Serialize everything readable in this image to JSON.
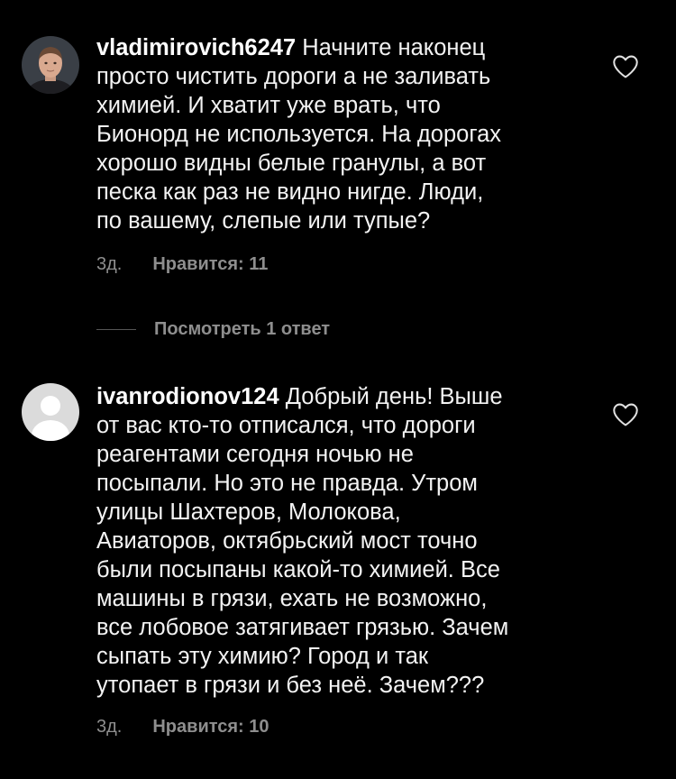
{
  "colors": {
    "background": "#000000",
    "text": "#f3f3f3",
    "meta": "#8e8e8e",
    "avatar_default_bg": "#dbdbdb"
  },
  "comments": [
    {
      "username": "vladimirovich6247",
      "avatar_icon": "user-photo-avatar",
      "lines": [
        "Начните наконец",
        "просто чистить дороги а не заливать",
        "химией. И хватит уже врать, что",
        "Бионорд не используется. На дорогах",
        "хорошо видны белые гранулы, а вот",
        "песка как раз не видно нигде. Люди,",
        "по вашему, слепые или тупые?"
      ],
      "time": "3д.",
      "likes": "Нравится: 11",
      "like_icon": "heart-outline-icon"
    },
    {
      "username": "ivanrodionov124",
      "avatar_icon": "default-user-avatar",
      "lines": [
        "Добрый день! Выше",
        "от вас кто-то отписался, что дороги",
        "реагентами сегодня ночью не",
        "посыпали. Но это не правда. Утром",
        "улицы Шахтеров, Молокова,",
        "Авиаторов, октябрьский мост точно",
        "были посыпаны какой-то химией. Все",
        "машины в грязи, ехать не возможно,",
        "все лобовое затягивает грязью. Зачем",
        "сыпать эту химию? Город и так",
        "утопает в грязи и без неё. Зачем???"
      ],
      "time": "3д.",
      "likes": "Нравится: 10",
      "like_icon": "heart-outline-icon"
    }
  ],
  "replies_label": "Посмотреть 1 ответ"
}
